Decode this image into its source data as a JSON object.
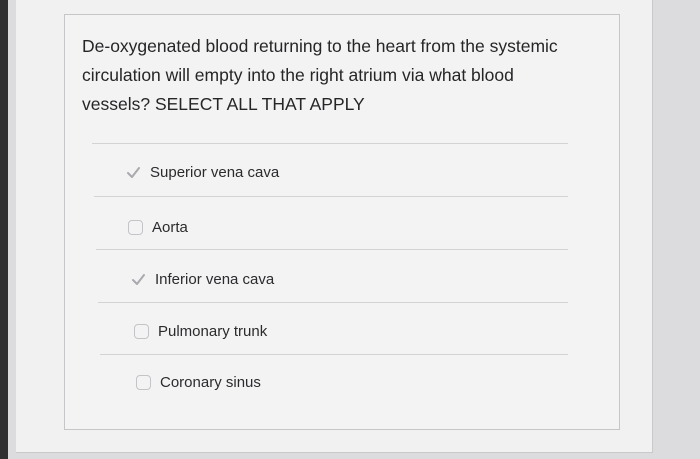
{
  "question": {
    "text": "De-oxygenated blood returning to the heart from the systemic circulation will empty into the right atrium via what blood vessels? SELECT ALL THAT APPLY"
  },
  "options": [
    {
      "label": "Superior vena cava",
      "checked": true
    },
    {
      "label": "Aorta",
      "checked": false
    },
    {
      "label": "Inferior vena cava",
      "checked": true
    },
    {
      "label": "Pulmonary trunk",
      "checked": false
    },
    {
      "label": "Coronary sinus",
      "checked": false
    }
  ],
  "icons": {
    "checked": "checkmark-icon",
    "unchecked": "empty-checkbox-icon"
  }
}
